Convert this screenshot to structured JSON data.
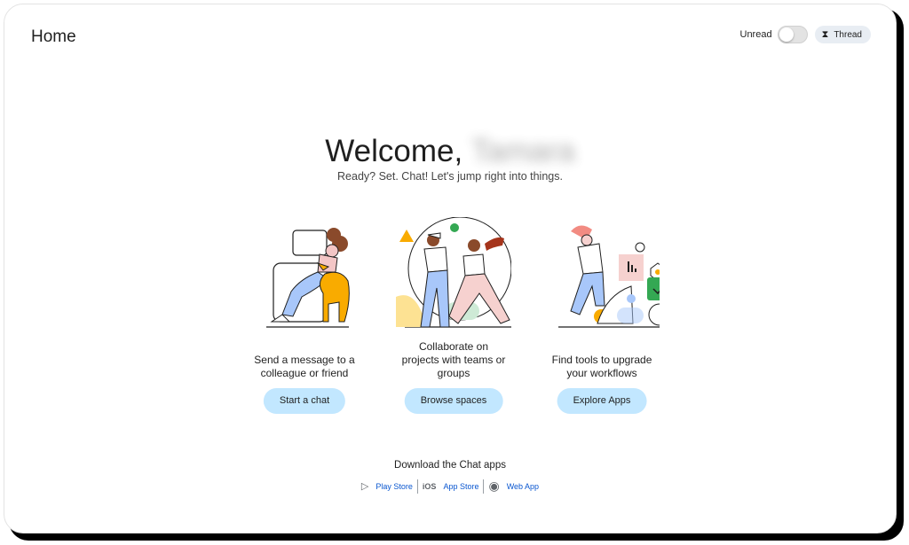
{
  "header": {
    "title": "Home",
    "unread_label": "Unread",
    "unread_on": false,
    "thread_label": "Thread"
  },
  "welcome": {
    "greeting": "Welcome,",
    "name_redacted": "Tamara",
    "subtitle": "Ready? Set. Chat! Let's jump right into things."
  },
  "cards": [
    {
      "text_line1": "Send a message to a",
      "text_line2": "colleague or friend",
      "button": "Start a chat"
    },
    {
      "text_line1": "Collaborate on",
      "text_line2": "projects with teams or",
      "text_line3": "groups",
      "button": "Browse spaces"
    },
    {
      "text_line1": "Find tools to upgrade",
      "text_line2": "your workflows",
      "button": "Explore Apps"
    }
  ],
  "download": {
    "title": "Download the Chat apps",
    "play_store": "Play Store",
    "ios_label": "iOS",
    "app_store": "App Store",
    "web_app": "Web App"
  },
  "colors": {
    "accent_button": "#c2e7ff",
    "link": "#0b57d0",
    "illustration_blue": "#a8c7fa",
    "illustration_yellow": "#f9ab00",
    "illustration_green": "#34a853",
    "illustration_red": "#ea4335"
  }
}
